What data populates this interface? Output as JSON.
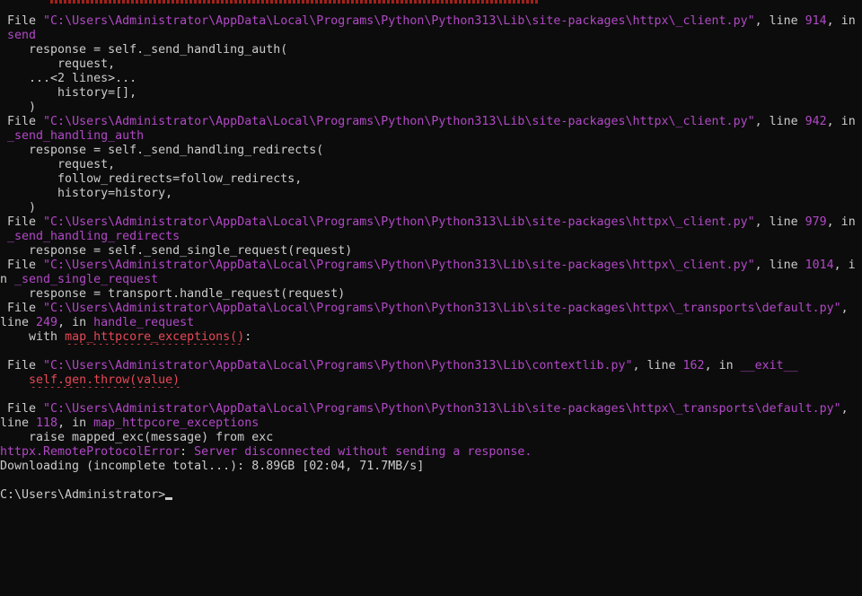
{
  "terminal": {
    "lines": [
      [
        {
          "t": " File ",
          "c": "plain"
        },
        {
          "t": "\"C:\\Users\\Administrator\\AppData\\Local\\Programs\\Python\\Python313\\Lib\\site-packages\\httpx\\_client.py\"",
          "c": "file-path"
        },
        {
          "t": ", line ",
          "c": "plain"
        },
        {
          "t": "914",
          "c": "num"
        },
        {
          "t": ", in",
          "c": "plain"
        }
      ],
      [
        {
          "t": " send",
          "c": "func-name"
        }
      ],
      [
        {
          "t": "    response = self._send_handling_auth(",
          "c": "plain"
        }
      ],
      [
        {
          "t": "        request,",
          "c": "plain"
        }
      ],
      [
        {
          "t": "    ...<2 lines>...",
          "c": "plain"
        }
      ],
      [
        {
          "t": "        history=[],",
          "c": "plain"
        }
      ],
      [
        {
          "t": "    )",
          "c": "plain"
        }
      ],
      [
        {
          "t": " File ",
          "c": "plain"
        },
        {
          "t": "\"C:\\Users\\Administrator\\AppData\\Local\\Programs\\Python\\Python313\\Lib\\site-packages\\httpx\\_client.py\"",
          "c": "file-path"
        },
        {
          "t": ", line ",
          "c": "plain"
        },
        {
          "t": "942",
          "c": "num"
        },
        {
          "t": ", in",
          "c": "plain"
        }
      ],
      [
        {
          "t": " _send_handling_auth",
          "c": "func-name"
        }
      ],
      [
        {
          "t": "    response = self._send_handling_redirects(",
          "c": "plain"
        }
      ],
      [
        {
          "t": "        request,",
          "c": "plain"
        }
      ],
      [
        {
          "t": "        follow_redirects=follow_redirects,",
          "c": "plain"
        }
      ],
      [
        {
          "t": "        history=history,",
          "c": "plain"
        }
      ],
      [
        {
          "t": "    )",
          "c": "plain"
        }
      ],
      [
        {
          "t": " File ",
          "c": "plain"
        },
        {
          "t": "\"C:\\Users\\Administrator\\AppData\\Local\\Programs\\Python\\Python313\\Lib\\site-packages\\httpx\\_client.py\"",
          "c": "file-path"
        },
        {
          "t": ", line ",
          "c": "plain"
        },
        {
          "t": "979",
          "c": "num"
        },
        {
          "t": ", in",
          "c": "plain"
        }
      ],
      [
        {
          "t": " _send_handling_redirects",
          "c": "func-name"
        }
      ],
      [
        {
          "t": "    response = self._send_single_request(request)",
          "c": "plain"
        }
      ],
      [
        {
          "t": " File ",
          "c": "plain"
        },
        {
          "t": "\"C:\\Users\\Administrator\\AppData\\Local\\Programs\\Python\\Python313\\Lib\\site-packages\\httpx\\_client.py\"",
          "c": "file-path"
        },
        {
          "t": ", line ",
          "c": "plain"
        },
        {
          "t": "1014",
          "c": "num"
        },
        {
          "t": ", i",
          "c": "plain"
        }
      ],
      [
        {
          "t": "n ",
          "c": "plain"
        },
        {
          "t": "_send_single_request",
          "c": "func-name"
        }
      ],
      [
        {
          "t": "    response = transport.handle_request(request)",
          "c": "plain"
        }
      ],
      [
        {
          "t": " File ",
          "c": "plain"
        },
        {
          "t": "\"C:\\Users\\Administrator\\AppData\\Local\\Programs\\Python\\Python313\\Lib\\site-packages\\httpx\\_transports\\default.py\"",
          "c": "file-path"
        },
        {
          "t": ",",
          "c": "plain"
        }
      ],
      [
        {
          "t": "line ",
          "c": "plain"
        },
        {
          "t": "249",
          "c": "num"
        },
        {
          "t": ", in ",
          "c": "plain"
        },
        {
          "t": "handle_request",
          "c": "func-name"
        }
      ],
      [
        {
          "t": "    with ",
          "c": "plain"
        },
        {
          "t": "map_httpcore_exceptions()",
          "c": "err-underline"
        },
        {
          "t": ":",
          "c": "plain"
        }
      ],
      [
        {
          "t": "",
          "c": "plain"
        }
      ],
      [
        {
          "t": " File ",
          "c": "plain"
        },
        {
          "t": "\"C:\\Users\\Administrator\\AppData\\Local\\Programs\\Python\\Python313\\Lib\\contextlib.py\"",
          "c": "file-path"
        },
        {
          "t": ", line ",
          "c": "plain"
        },
        {
          "t": "162",
          "c": "num"
        },
        {
          "t": ", in ",
          "c": "plain"
        },
        {
          "t": "__exit__",
          "c": "func-name"
        }
      ],
      [
        {
          "t": "    ",
          "c": "plain"
        },
        {
          "t": "self.gen.throw(value)",
          "c": "err-underline"
        }
      ],
      [
        {
          "t": "",
          "c": "plain"
        }
      ],
      [
        {
          "t": " File ",
          "c": "plain"
        },
        {
          "t": "\"C:\\Users\\Administrator\\AppData\\Local\\Programs\\Python\\Python313\\Lib\\site-packages\\httpx\\_transports\\default.py\"",
          "c": "file-path"
        },
        {
          "t": ",",
          "c": "plain"
        }
      ],
      [
        {
          "t": "line ",
          "c": "plain"
        },
        {
          "t": "118",
          "c": "num"
        },
        {
          "t": ", in ",
          "c": "plain"
        },
        {
          "t": "map_httpcore_exceptions",
          "c": "func-name"
        }
      ],
      [
        {
          "t": "    raise mapped_exc(message) from exc",
          "c": "plain"
        }
      ],
      [
        {
          "t": "httpx.RemoteProtocolError",
          "c": "err-type"
        },
        {
          "t": ": ",
          "c": "plain"
        },
        {
          "t": "Server disconnected without sending a response.",
          "c": "err-msg"
        }
      ],
      [
        {
          "t": "Downloading (incomplete total...): 8.89GB [02:04, 71.7MB/s]",
          "c": "plain"
        }
      ],
      [
        {
          "t": "",
          "c": "plain"
        }
      ],
      [
        {
          "t": "C:\\Users\\Administrator>",
          "c": "plain"
        },
        {
          "t": "",
          "c": "cursor"
        }
      ]
    ]
  }
}
